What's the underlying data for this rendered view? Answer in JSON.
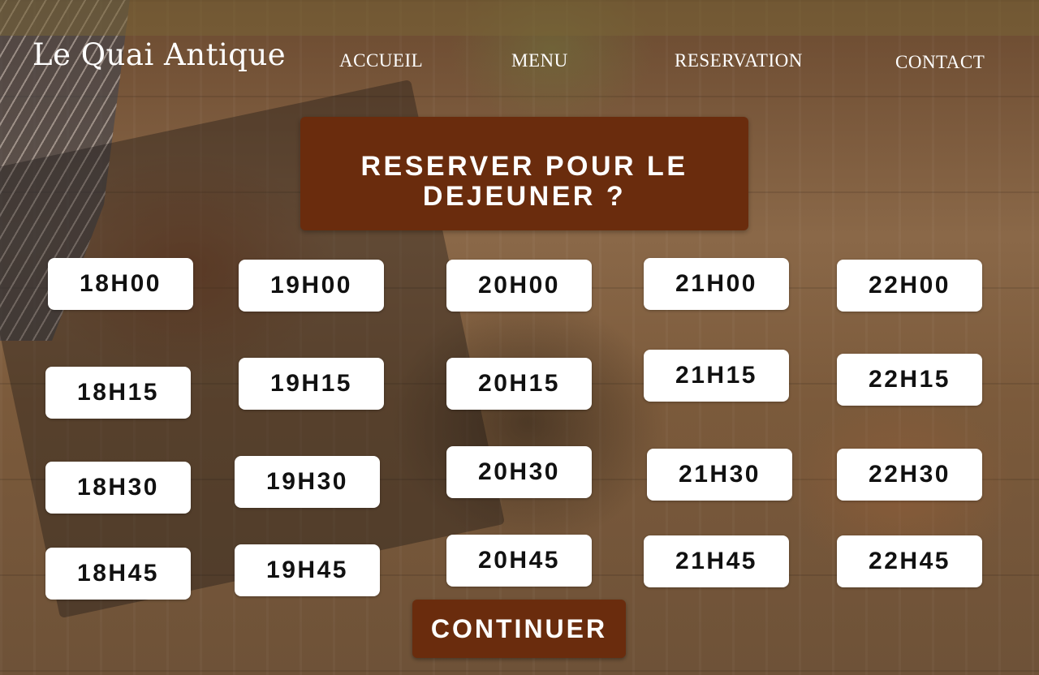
{
  "logo": "Le Quai Antique",
  "nav": {
    "accueil": "ACCUEIL",
    "menu": "MENU",
    "reservation": "RESERVATION",
    "contact": "CONTACT"
  },
  "banner": {
    "title": "RESERVER POUR LE DEJEUNER ?"
  },
  "time_slots": [
    [
      "18H00",
      "18H15",
      "18H30",
      "18H45"
    ],
    [
      "19H00",
      "19H15",
      "19H30",
      "19H45"
    ],
    [
      "20H00",
      "20H15",
      "20H30",
      "20H45"
    ],
    [
      "21H00",
      "21H15",
      "21H30",
      "21H45"
    ],
    [
      "22H00",
      "22H15",
      "22H30",
      "22H45"
    ]
  ],
  "continue_label": "CONTINUER",
  "colors": {
    "accent": "#6a2c0d",
    "slot_background": "#ffffff",
    "slot_text": "#111111",
    "nav_text": "#ffffff"
  }
}
